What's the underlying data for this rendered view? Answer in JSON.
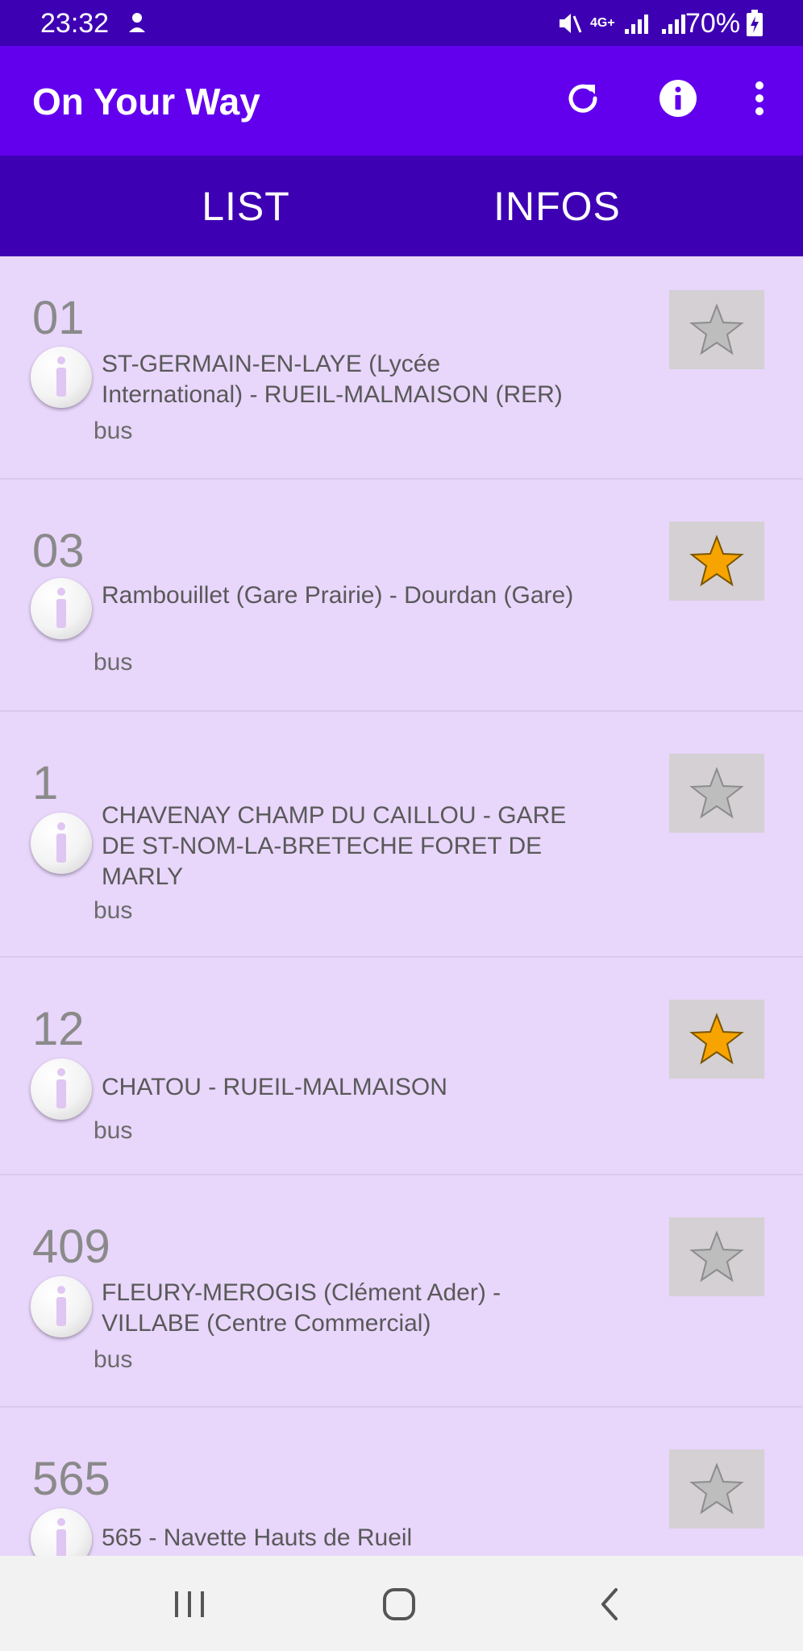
{
  "status": {
    "time": "23:32",
    "battery": "70%",
    "network": "4G+"
  },
  "appbar": {
    "title": "On Your Way"
  },
  "tabs": [
    {
      "label": "LIST",
      "selected": true
    },
    {
      "label": "INFOS",
      "selected": false
    }
  ],
  "lines": [
    {
      "number": "01",
      "name": "ST-GERMAIN-EN-LAYE (Lycée International) - RUEIL-MALMAISON (RER)",
      "type": "bus",
      "favorite": false
    },
    {
      "number": "03",
      "name": "Rambouillet (Gare Prairie) - Dourdan (Gare)",
      "type": "bus",
      "favorite": true
    },
    {
      "number": "1",
      "name": "CHAVENAY CHAMP DU CAILLOU - GARE DE ST-NOM-LA-BRETECHE FORET DE MARLY",
      "type": "bus",
      "favorite": false
    },
    {
      "number": "12",
      "name": "CHATOU - RUEIL-MALMAISON",
      "type": "bus",
      "favorite": true
    },
    {
      "number": "409",
      "name": "FLEURY-MEROGIS (Clément Ader) - VILLABE (Centre Commercial)",
      "type": "bus",
      "favorite": false
    },
    {
      "number": "565",
      "name": "565 - Navette Hauts de Rueil",
      "type": "",
      "favorite": false
    }
  ],
  "colors": {
    "status_bar": "#3E00B3",
    "app_bar": "#6200EE",
    "list_background": "#E8D6FB",
    "star_on": "#F7A400",
    "star_off": "#BDBDBD"
  },
  "icons": {
    "refresh": "refresh-icon",
    "info": "info-icon",
    "overflow": "more-vert-icon",
    "favorite": "star-icon"
  }
}
